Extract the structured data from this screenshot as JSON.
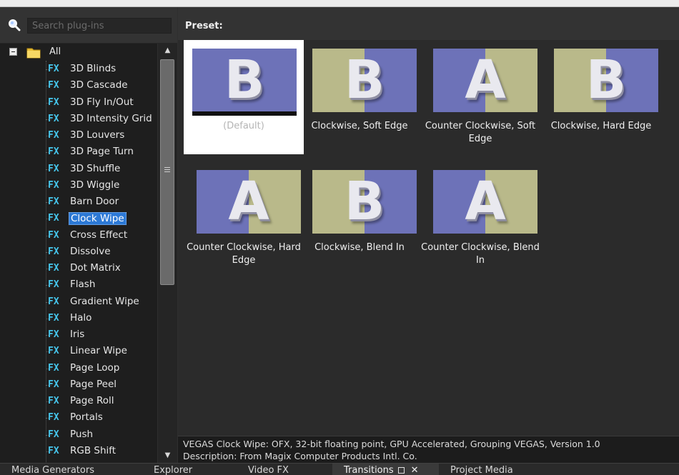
{
  "search": {
    "placeholder": "Search plug-ins",
    "value": ""
  },
  "tree": {
    "root_label": "All",
    "items": [
      {
        "label": "3D Blinds"
      },
      {
        "label": "3D Cascade"
      },
      {
        "label": "3D Fly In/Out"
      },
      {
        "label": "3D Intensity Grid"
      },
      {
        "label": "3D Louvers"
      },
      {
        "label": "3D Page Turn"
      },
      {
        "label": "3D Shuffle"
      },
      {
        "label": "3D Wiggle"
      },
      {
        "label": "Barn Door"
      },
      {
        "label": "Clock Wipe",
        "selected": true
      },
      {
        "label": "Cross Effect"
      },
      {
        "label": "Dissolve"
      },
      {
        "label": "Dot Matrix"
      },
      {
        "label": "Flash"
      },
      {
        "label": "Gradient Wipe"
      },
      {
        "label": "Halo"
      },
      {
        "label": "Iris"
      },
      {
        "label": "Linear Wipe"
      },
      {
        "label": "Page Loop"
      },
      {
        "label": "Page Peel"
      },
      {
        "label": "Page Roll"
      },
      {
        "label": "Portals"
      },
      {
        "label": "Push"
      },
      {
        "label": "RGB Shift"
      }
    ],
    "fx_badge": "FX"
  },
  "preset_header": {
    "label": "Preset:"
  },
  "presets": [
    {
      "caption": "(Default)",
      "letter": "B",
      "selected": true,
      "style": "blue"
    },
    {
      "caption": "Clockwise, Soft Edge",
      "letter": "B",
      "style": "split"
    },
    {
      "caption": "Counter Clockwise, Soft Edge",
      "letter": "A",
      "style": "split-rev"
    },
    {
      "caption": "Clockwise, Hard Edge",
      "letter": "B",
      "style": "split"
    },
    {
      "caption": "Counter Clockwise, Hard Edge",
      "letter": "A",
      "style": "split-rev"
    },
    {
      "caption": "Clockwise, Blend In",
      "letter": "B",
      "style": "split"
    },
    {
      "caption": "Counter Clockwise, Blend In",
      "letter": "A",
      "style": "split-rev"
    }
  ],
  "status": {
    "line1": "VEGAS Clock Wipe: OFX, 32-bit floating point, GPU Accelerated, Grouping VEGAS, Version 1.0",
    "line2": "Description: From Magix Computer Products Intl. Co."
  },
  "tabs": [
    {
      "label": "Media Generators"
    },
    {
      "label": "Explorer"
    },
    {
      "label": "Video FX"
    },
    {
      "label": "Transitions",
      "active": true
    },
    {
      "label": "Project Media"
    }
  ],
  "colors": {
    "fx_badge": "#46c6ec",
    "selection": "#2c79d6",
    "thumb_blue": "#6d72b8",
    "thumb_khaki": "#b9b98a"
  }
}
